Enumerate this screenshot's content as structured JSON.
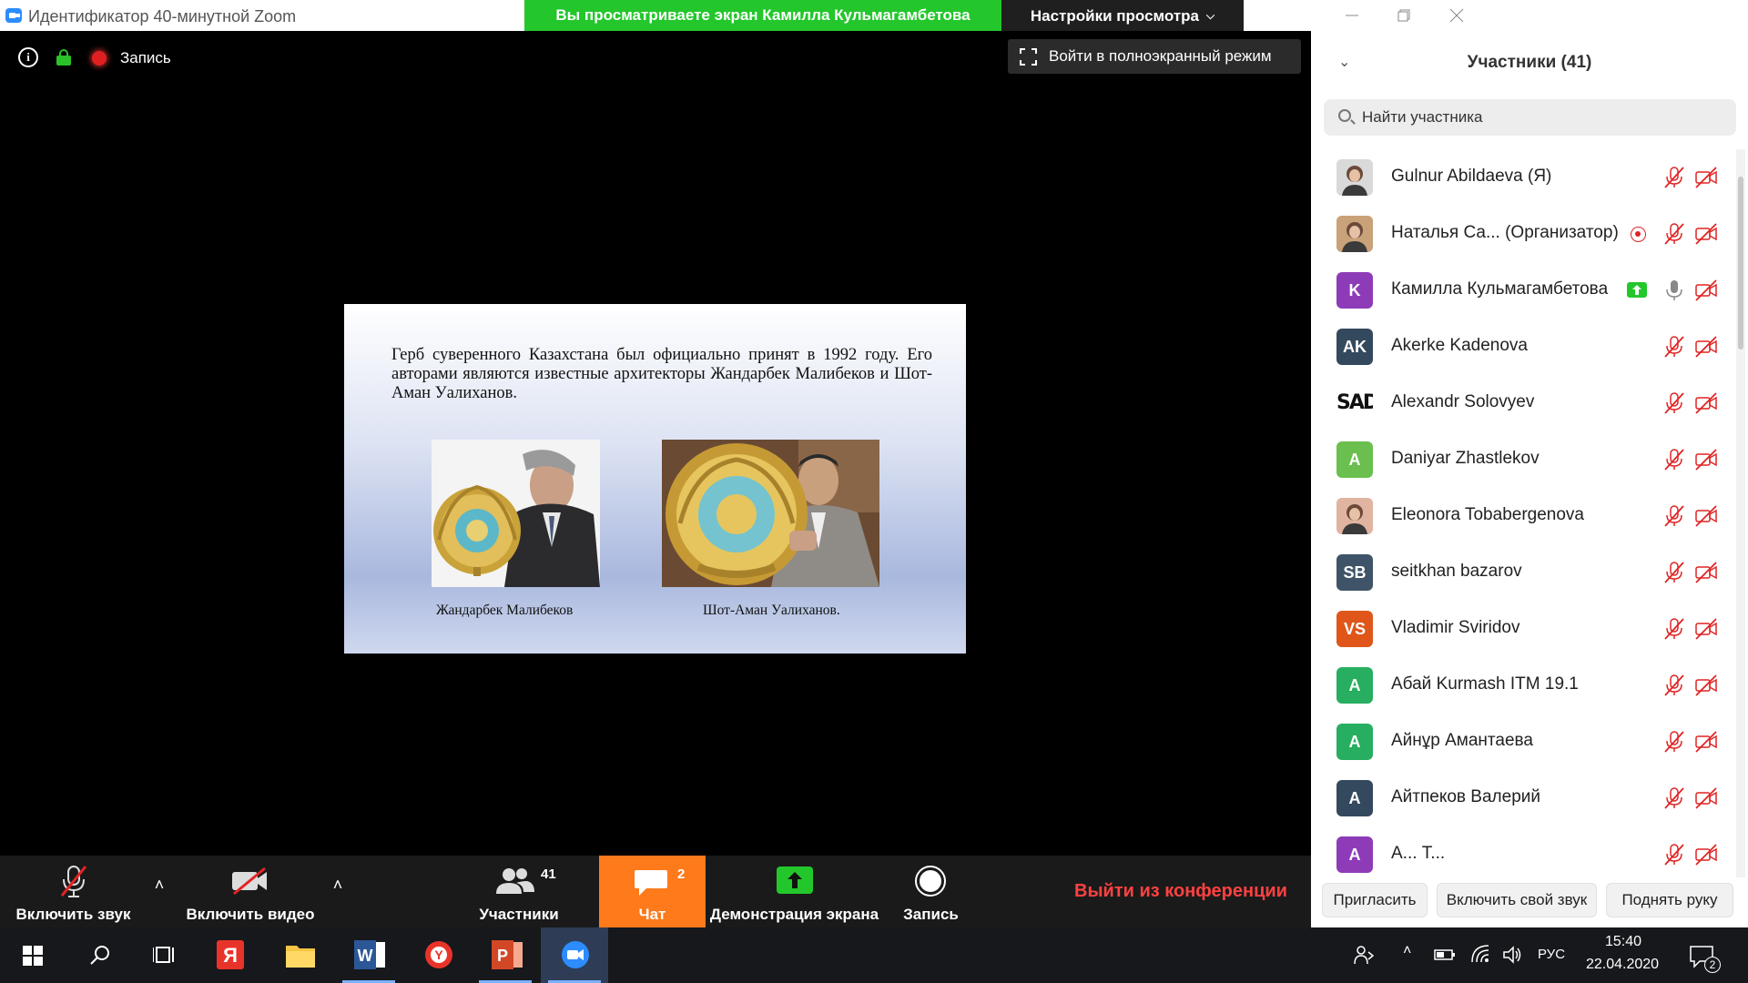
{
  "window": {
    "title": "Идентификатор 40-минутной Zoom",
    "share_banner": "Вы просматриваете экран Камилла Кульмагамбетова",
    "view_settings": "Настройки просмотра"
  },
  "meeting_bar": {
    "recording_label": "Запись",
    "fullscreen_label": "Войти в полноэкранный режим"
  },
  "slide": {
    "text": "Герб суверенного Казахстана был официально принят в 1992 году. Его авторами являются известные архитекторы Жандарбек Малибеков и Шот-Аман Уалиханов.",
    "caption_1": "Жандарбек Малибеков",
    "caption_2": "Шот-Аман Уалиханов."
  },
  "toolbar": {
    "unmute_label": "Включить звук",
    "video_label": "Включить видео",
    "participants_label": "Участники",
    "participants_count": "41",
    "chat_label": "Чат",
    "chat_count": "2",
    "share_label": "Демонстрация экрана",
    "record_label": "Запись",
    "leave_label": "Выйти из конференции"
  },
  "panel": {
    "title": "Участники (41)",
    "search_placeholder": "Найти участника",
    "participants": [
      {
        "name": "Gulnur Abildaeva (Я)",
        "avatar": "photo",
        "avatar_color": "#d9d9d9"
      },
      {
        "name": "Наталья Са...  (Организатор)",
        "avatar": "photo",
        "avatar_color": "#c9a27a"
      },
      {
        "name": "Камилла Кульмагамбетова",
        "avatar": "K",
        "avatar_color": "#8e3bb8"
      },
      {
        "name": "Akerke Kadenova",
        "avatar": "AK",
        "avatar_color": "#34495e"
      },
      {
        "name": "Alexandr Solovyev",
        "avatar": "SAD",
        "avatar_color": "#ffffff"
      },
      {
        "name": "Daniyar Zhastlekov",
        "avatar": "A",
        "avatar_color": "#6bbf4e"
      },
      {
        "name": "Eleonora Tobabergenova",
        "avatar": "photo",
        "avatar_color": "#e0b4a0"
      },
      {
        "name": "seitkhan bazarov",
        "avatar": "SB",
        "avatar_color": "#3f5468"
      },
      {
        "name": "Vladimir Sviridov",
        "avatar": "VS",
        "avatar_color": "#e0561a"
      },
      {
        "name": "Абай Kurmash ITM 19.1",
        "avatar": "A",
        "avatar_color": "#27ae60"
      },
      {
        "name": "Айнұр Амантаева",
        "avatar": "A",
        "avatar_color": "#27ae60"
      },
      {
        "name": "Айтпеков Валерий",
        "avatar": "A",
        "avatar_color": "#34495e"
      },
      {
        "name": "А... Т...",
        "avatar": "A",
        "avatar_color": "#8e3bb8"
      }
    ],
    "invite_label": "Пригласить",
    "unmute_me_label": "Включить свой звук",
    "raise_hand_label": "Поднять руку"
  },
  "taskbar": {
    "lang": "РУС",
    "time": "15:40",
    "date": "22.04.2020",
    "notifications_count": "2"
  },
  "colors": {
    "share_green": "#23c72c",
    "chat_orange": "#ff7a1a",
    "leave_red": "#ff4141",
    "muted_red": "#e02424"
  }
}
